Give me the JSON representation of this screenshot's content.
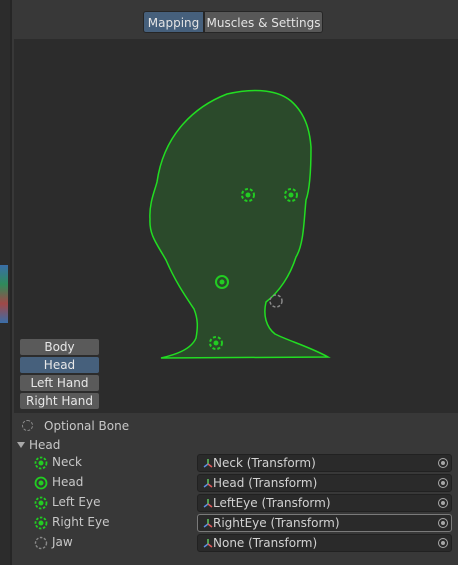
{
  "tabs": {
    "mapping": "Mapping",
    "muscles": "Muscles & Settings",
    "active": "mapping"
  },
  "body_parts": [
    "Body",
    "Head",
    "Left Hand",
    "Right Hand"
  ],
  "active_part": "Head",
  "legend": {
    "optional_bone": "Optional Bone"
  },
  "group": {
    "label": "Head",
    "expanded": true
  },
  "bones": [
    {
      "label": "Neck",
      "value": "Neck (Transform)",
      "state": "optional-mapped"
    },
    {
      "label": "Head",
      "value": "Head (Transform)",
      "state": "required-mapped"
    },
    {
      "label": "Left Eye",
      "value": "LeftEye (Transform)",
      "state": "optional-mapped"
    },
    {
      "label": "Right Eye",
      "value": "RightEye (Transform)",
      "state": "optional-mapped",
      "focused": true
    },
    {
      "label": "Jaw",
      "value": "None (Transform)",
      "state": "optional-empty"
    }
  ],
  "colors": {
    "accent": "#46607c",
    "mapped_green": "#22cc22",
    "head_fill": "#2b4a2b",
    "unmapped_gray": "#8a8a8a"
  }
}
